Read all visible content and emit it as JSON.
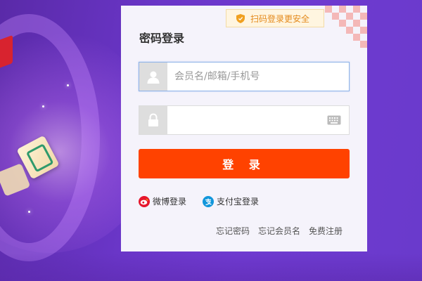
{
  "security_tip": {
    "text": "扫码登录更安全",
    "icon": "shield-icon",
    "color": "#e48a1c"
  },
  "login_form": {
    "title": "密码登录",
    "username": {
      "placeholder": "会员名/邮箱/手机号",
      "value": "",
      "icon": "user-icon"
    },
    "password": {
      "placeholder": "",
      "value": "",
      "icon": "lock-icon",
      "keyboard_icon": "keyboard-icon"
    },
    "submit_label": "登 录",
    "submit_color": "#ff4200"
  },
  "alt_login": [
    {
      "label": "微博登录",
      "icon": "weibo-icon",
      "color": "#e6162d"
    },
    {
      "label": "支付宝登录",
      "icon": "alipay-icon",
      "color": "#1296db"
    }
  ],
  "footer_links": [
    "忘记密码",
    "忘记会员名",
    "免费注册"
  ]
}
